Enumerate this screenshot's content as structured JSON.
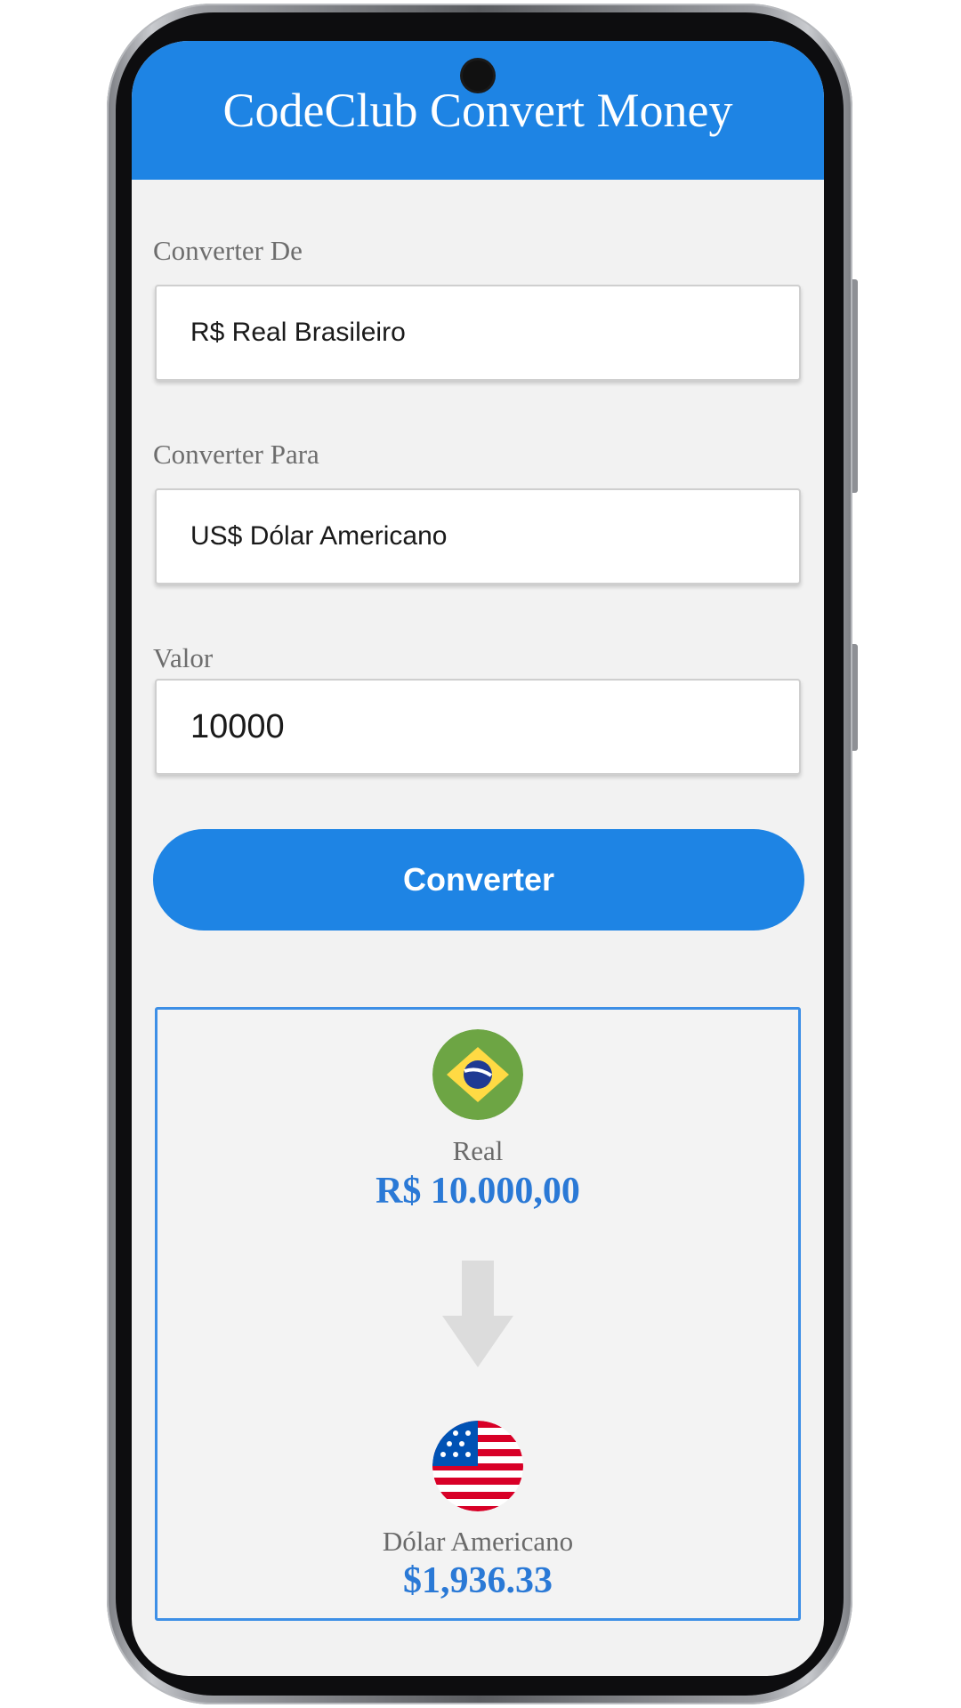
{
  "app": {
    "title": "CodeClub Convert Money"
  },
  "form": {
    "from_label": "Converter De",
    "from_value": "R$ Real Brasileiro",
    "to_label": "Converter Para",
    "to_value": "US$ Dólar Americano",
    "amount_label": "Valor",
    "amount_value": "10000",
    "convert_label": "Converter"
  },
  "result": {
    "from_currency": {
      "name": "Real",
      "value": "R$ 10.000,00",
      "flag_icon": "brazil-flag-icon"
    },
    "arrow_icon": "arrow-down-icon",
    "to_currency": {
      "name": "Dólar Americano",
      "value": "$1,936.33",
      "flag_icon": "usa-flag-icon"
    }
  },
  "colors": {
    "primary": "#1e84e4",
    "value_text": "#2a79d6",
    "background": "#f2f2f2",
    "result_border": "#3d8fe6"
  }
}
